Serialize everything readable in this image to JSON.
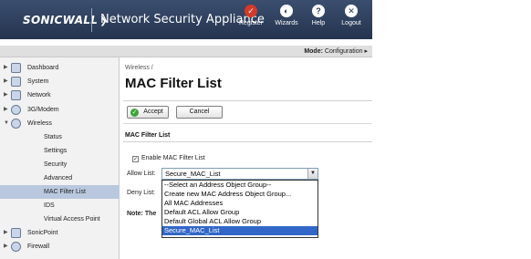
{
  "header": {
    "logo": "SONICWALL",
    "product": "Network Security Appliance",
    "buttons": [
      {
        "label": "Register",
        "glyph": "✓",
        "icon": "register-icon"
      },
      {
        "label": "Wizards",
        "glyph": "◐",
        "icon": "wizards-icon"
      },
      {
        "label": "Help",
        "glyph": "?",
        "icon": "help-icon"
      },
      {
        "label": "Logout",
        "glyph": "✕",
        "icon": "logout-icon"
      }
    ]
  },
  "modebar": {
    "label": "Mode:",
    "value": "Configuration ▸"
  },
  "sidebar": {
    "items": [
      {
        "label": "Dashboard",
        "icon": "dashboard-icon"
      },
      {
        "label": "System",
        "icon": "system-icon"
      },
      {
        "label": "Network",
        "icon": "network-icon"
      },
      {
        "label": "3G/Modem",
        "icon": "modem-icon"
      },
      {
        "label": "Wireless",
        "icon": "wireless-icon"
      }
    ],
    "subitems": [
      "Status",
      "Settings",
      "Security",
      "Advanced",
      "MAC Filter List",
      "IDS",
      "Virtual Access Point"
    ],
    "active_subitem": "MAC Filter List",
    "after_items": [
      {
        "label": "SonicPoint",
        "icon": "sonicpoint-icon"
      },
      {
        "label": "Firewall",
        "icon": "firewall-icon"
      }
    ]
  },
  "main": {
    "breadcrumb": "Wireless /",
    "title": "MAC Filter List",
    "accept_label": "Accept",
    "cancel_label": "Cancel",
    "section_title": "MAC Filter List",
    "enable_label": "Enable MAC Filter List",
    "enable_checked": true,
    "allow_label": "Allow List:",
    "deny_label": "Deny List:",
    "note_label": "Note: The",
    "select_value": "Secure_MAC_List",
    "options": [
      "--Select an Address Object Group--",
      "Create new MAC Address Object Group...",
      "All MAC Addresses",
      "Default ACL Allow Group",
      "Default Global ACL Allow Group",
      "Secure_MAC_List"
    ],
    "selected_option": "Secure_MAC_List"
  },
  "colors": {
    "header_bg": "#2c3d5c",
    "register": "#d23a2a",
    "selected_row": "#b9c8de",
    "option_highlight": "#3267c8"
  }
}
